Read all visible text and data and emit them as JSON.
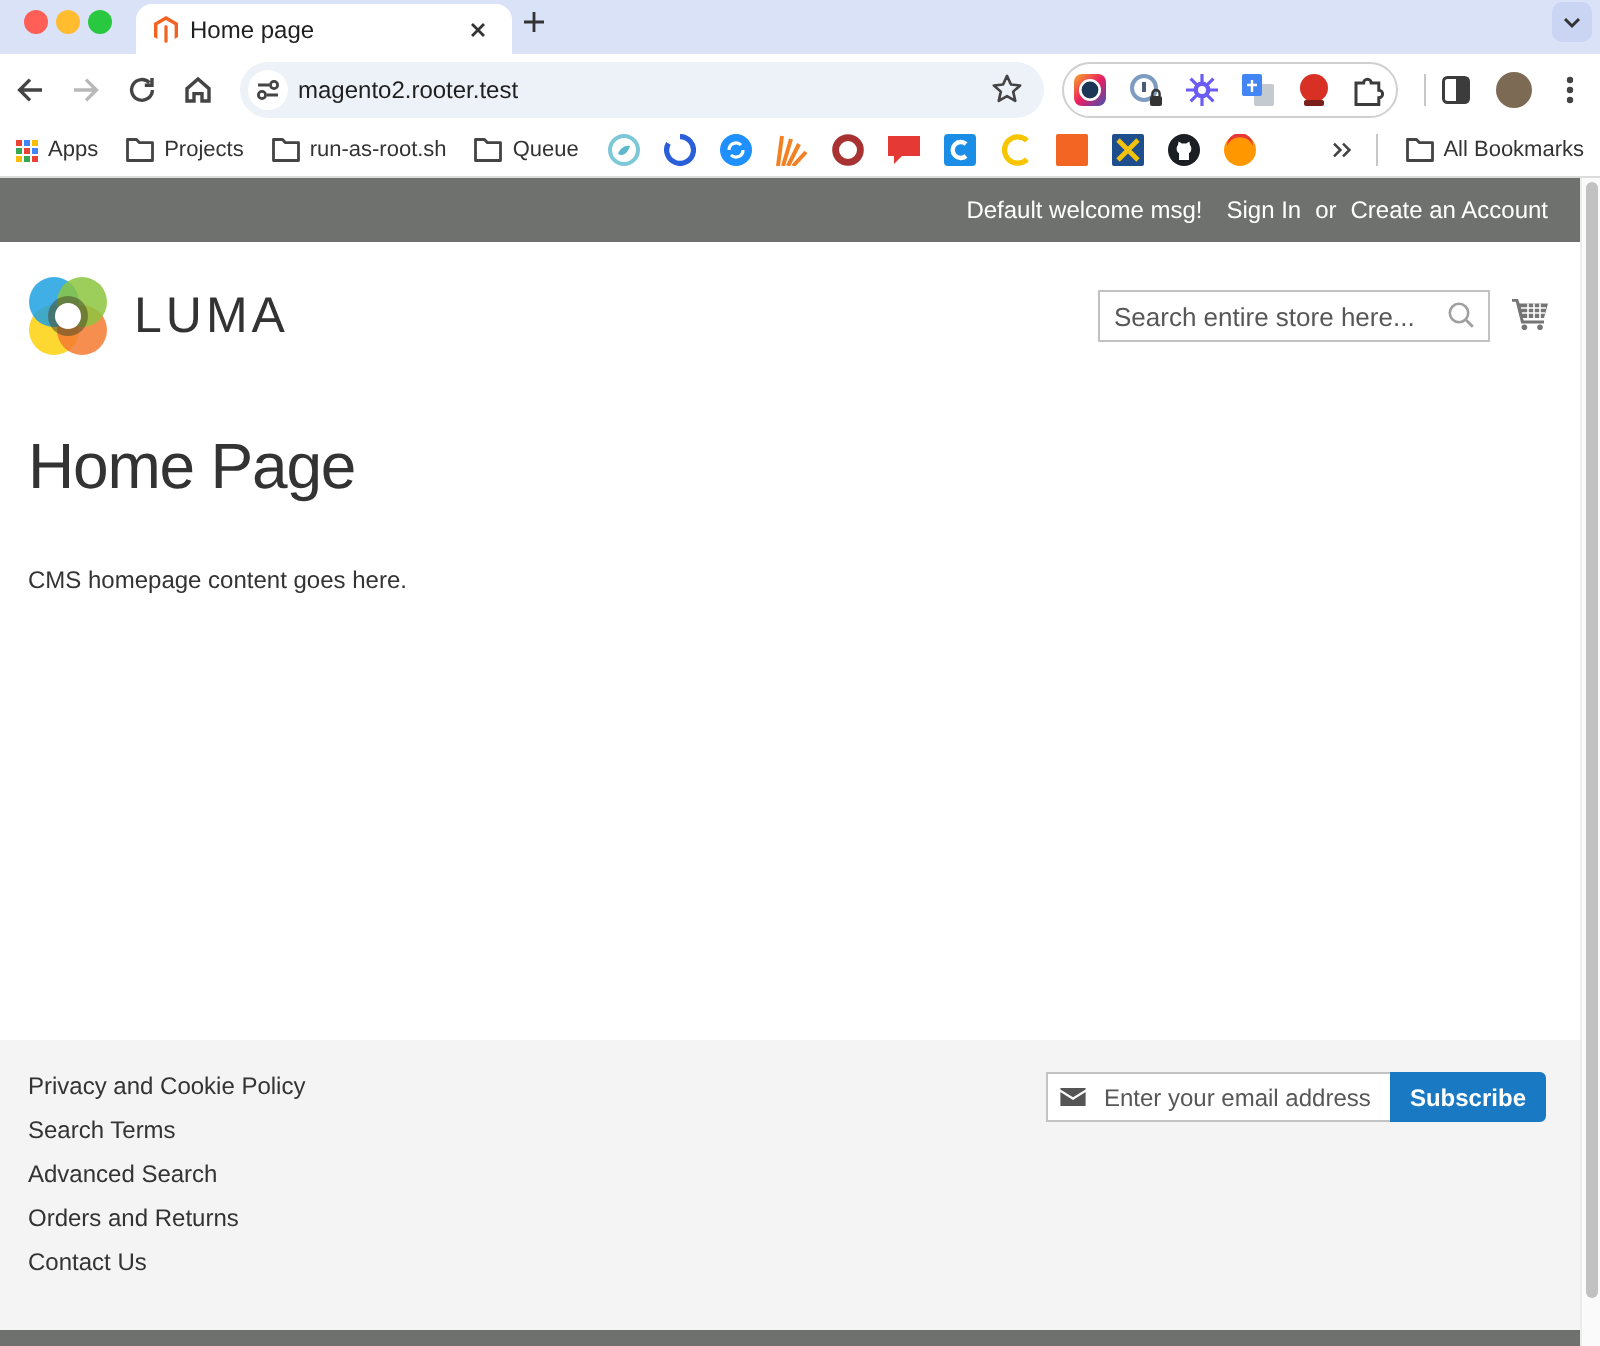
{
  "browser": {
    "tabs": [
      {
        "title": "Home page",
        "selected": true
      }
    ],
    "navigation": [
      {
        "kind": "back",
        "disabled": false
      },
      {
        "kind": "forward",
        "disabled": true
      },
      {
        "kind": "reload",
        "disabled": false
      },
      {
        "kind": "home",
        "disabled": false
      }
    ],
    "address_bar": {
      "url": "magento2.rooter.test"
    },
    "bookmarks": [
      {
        "kind": "apps",
        "label": "Apps"
      },
      {
        "kind": "folder",
        "label": "Projects"
      },
      {
        "kind": "folder",
        "label": "run-as-root.sh"
      },
      {
        "kind": "folder",
        "label": "Queue"
      }
    ],
    "all_bookmarks": {
      "label": "All Bookmarks"
    }
  },
  "page": {
    "top_links": [
      {
        "kind": "text",
        "label": "Default welcome msg!"
      },
      {
        "kind": "link",
        "label": "Sign In"
      },
      {
        "kind": "text",
        "label": "or"
      },
      {
        "kind": "link",
        "label": "Create an Account"
      }
    ],
    "logo": {
      "text": "LUMA"
    },
    "search": {
      "placeholder": "Search entire store here..."
    },
    "title": "Home Page",
    "content": "CMS homepage content goes here.",
    "footer": {
      "links": [
        "Privacy and Cookie Policy",
        "Search Terms",
        "Advanced Search",
        "Orders and Returns",
        "Contact Us"
      ],
      "newsletter": {
        "placeholder": "Enter your email address",
        "button": "Subscribe"
      }
    }
  }
}
